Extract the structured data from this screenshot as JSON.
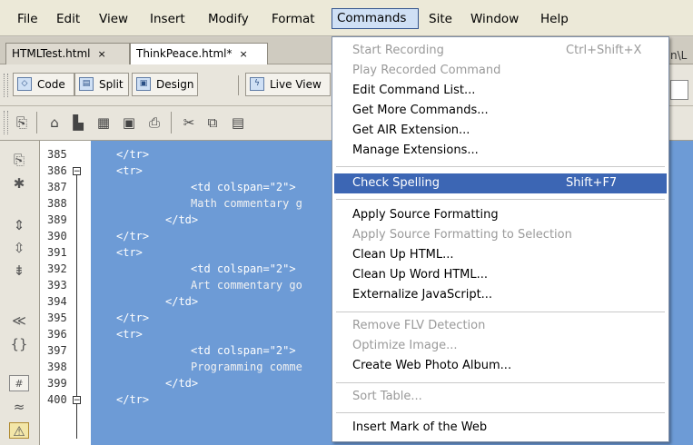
{
  "menubar": {
    "items": [
      {
        "label": "File"
      },
      {
        "label": "Edit"
      },
      {
        "label": "View"
      },
      {
        "label": "Insert"
      },
      {
        "label": "Modify"
      },
      {
        "label": "Format"
      },
      {
        "label": "Commands"
      },
      {
        "label": "Site"
      },
      {
        "label": "Window"
      },
      {
        "label": "Help"
      }
    ]
  },
  "tabs": [
    {
      "label": "HTMLTest.html",
      "close": "×"
    },
    {
      "label": "ThinkPeace.html*",
      "close": "×"
    }
  ],
  "path_fragment": "n\\L",
  "toolbar": {
    "code_label": "Code",
    "split_label": "Split",
    "design_label": "Design",
    "liveview_label": "Live View"
  },
  "editor": {
    "line_numbers": [
      "385",
      "386",
      "387",
      "388",
      "389",
      "390",
      "391",
      "392",
      "393",
      "394",
      "395",
      "396",
      "397",
      "398",
      "399",
      "400"
    ],
    "lines": [
      "</tr>",
      "<tr>",
      "<td colspan=\"2\">",
      "Math commentary g",
      "</td>",
      "</tr>",
      "<tr>",
      "<td colspan=\"2\">",
      "Art commentary go",
      "</td>",
      "</tr>",
      "<tr>",
      "<td colspan=\"2\">",
      "Programming comme",
      "</td>",
      "</tr>"
    ]
  },
  "commands_menu": {
    "items": [
      {
        "label": "Start Recording",
        "shortcut": "Ctrl+Shift+X",
        "disabled": true
      },
      {
        "label": "Play Recorded Command",
        "shortcut": "",
        "disabled": true
      },
      {
        "label": "Edit Command List...",
        "shortcut": "",
        "disabled": false
      },
      {
        "label": "Get More Commands...",
        "shortcut": "",
        "disabled": false
      },
      {
        "label": "Get AIR Extension...",
        "shortcut": "",
        "disabled": false
      },
      {
        "label": "Manage Extensions...",
        "shortcut": "",
        "disabled": false
      },
      {
        "label": "Check Spelling",
        "shortcut": "Shift+F7",
        "disabled": false,
        "highlighted": true
      },
      {
        "label": "Apply Source Formatting",
        "shortcut": "",
        "disabled": false
      },
      {
        "label": "Apply Source Formatting to Selection",
        "shortcut": "",
        "disabled": true
      },
      {
        "label": "Clean Up HTML...",
        "shortcut": "",
        "disabled": false
      },
      {
        "label": "Clean Up Word HTML...",
        "shortcut": "",
        "disabled": false
      },
      {
        "label": "Externalize JavaScript...",
        "shortcut": "",
        "disabled": false
      },
      {
        "label": "Remove FLV Detection",
        "shortcut": "",
        "disabled": true
      },
      {
        "label": "Optimize Image...",
        "shortcut": "",
        "disabled": true
      },
      {
        "label": "Create Web Photo Album...",
        "shortcut": "",
        "disabled": false
      },
      {
        "label": "Sort Table...",
        "shortcut": "",
        "disabled": true
      },
      {
        "label": "Insert Mark of the Web",
        "shortcut": "",
        "disabled": false
      }
    ]
  },
  "colors": {
    "selection": "#6d9bd6",
    "menu_highlight": "#3c66b4"
  }
}
